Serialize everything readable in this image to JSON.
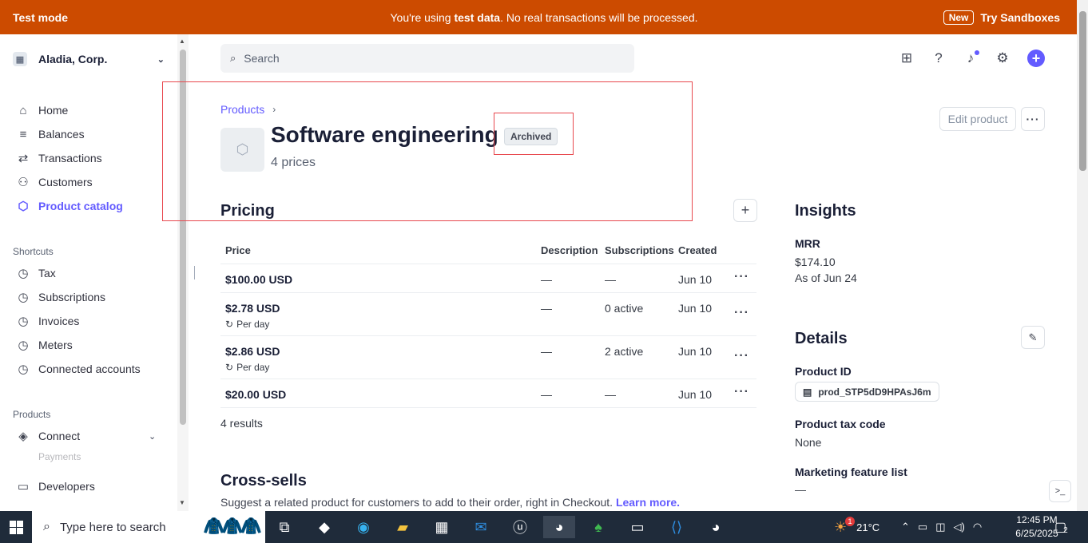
{
  "banner": {
    "mode": "Test mode",
    "msg_prefix": "You're using ",
    "msg_bold": "test data",
    "msg_suffix": ". No real transactions will be processed.",
    "new_badge": "New",
    "sandbox_link": "Try Sandboxes"
  },
  "sidebar": {
    "account": "Aladia, Corp.",
    "main": [
      {
        "label": "Home",
        "icon": "home-icon"
      },
      {
        "label": "Balances",
        "icon": "balances-icon"
      },
      {
        "label": "Transactions",
        "icon": "transactions-icon"
      },
      {
        "label": "Customers",
        "icon": "customers-icon"
      },
      {
        "label": "Product catalog",
        "icon": "product-catalog-icon"
      }
    ],
    "shortcuts_label": "Shortcuts",
    "shortcuts": [
      "Tax",
      "Subscriptions",
      "Invoices",
      "Meters",
      "Connected accounts"
    ],
    "products_label": "Products",
    "products": [
      "Connect",
      "Payments"
    ],
    "developers": "Developers"
  },
  "search": {
    "placeholder": "Search"
  },
  "product": {
    "breadcrumb": "Products",
    "title": "Software engineering",
    "status": "Archived",
    "price_count": "4 prices",
    "edit_button": "Edit product",
    "more_button": "···"
  },
  "pricing": {
    "title": "Pricing",
    "add_button": "+",
    "columns": [
      "Price",
      "Description",
      "Subscriptions",
      "Created"
    ],
    "rows": [
      {
        "price": "$100.00 USD",
        "interval": "",
        "description": "—",
        "subscriptions": "—",
        "created": "Jun 10"
      },
      {
        "price": "$2.78 USD",
        "interval": "Per day",
        "description": "—",
        "subscriptions": "0 active",
        "created": "Jun 10"
      },
      {
        "price": "$2.86 USD",
        "interval": "Per day",
        "description": "—",
        "subscriptions": "2 active",
        "created": "Jun 10"
      },
      {
        "price": "$20.00 USD",
        "interval": "",
        "description": "—",
        "subscriptions": "—",
        "created": "Jun 10"
      }
    ],
    "results": "4 results"
  },
  "cross_sells": {
    "title": "Cross-sells",
    "desc": "Suggest a related product for customers to add to their order, right in Checkout.",
    "link": "Learn more."
  },
  "insights": {
    "title": "Insights",
    "mrr_label": "MRR",
    "mrr_value": "$174.10",
    "mrr_date": "As of Jun 24"
  },
  "details": {
    "title": "Details",
    "product_id_label": "Product ID",
    "product_id": "prod_STP5dD9HPAsJ6m",
    "tax_code_label": "Product tax code",
    "tax_code": "None",
    "features_label": "Marketing feature list",
    "features": "—"
  },
  "taskbar": {
    "search_placeholder": "Type here to search",
    "weather": "21°C",
    "weather_badge": "1",
    "time": "12:45 PM",
    "date": "6/25/2025",
    "notifications": "2"
  }
}
